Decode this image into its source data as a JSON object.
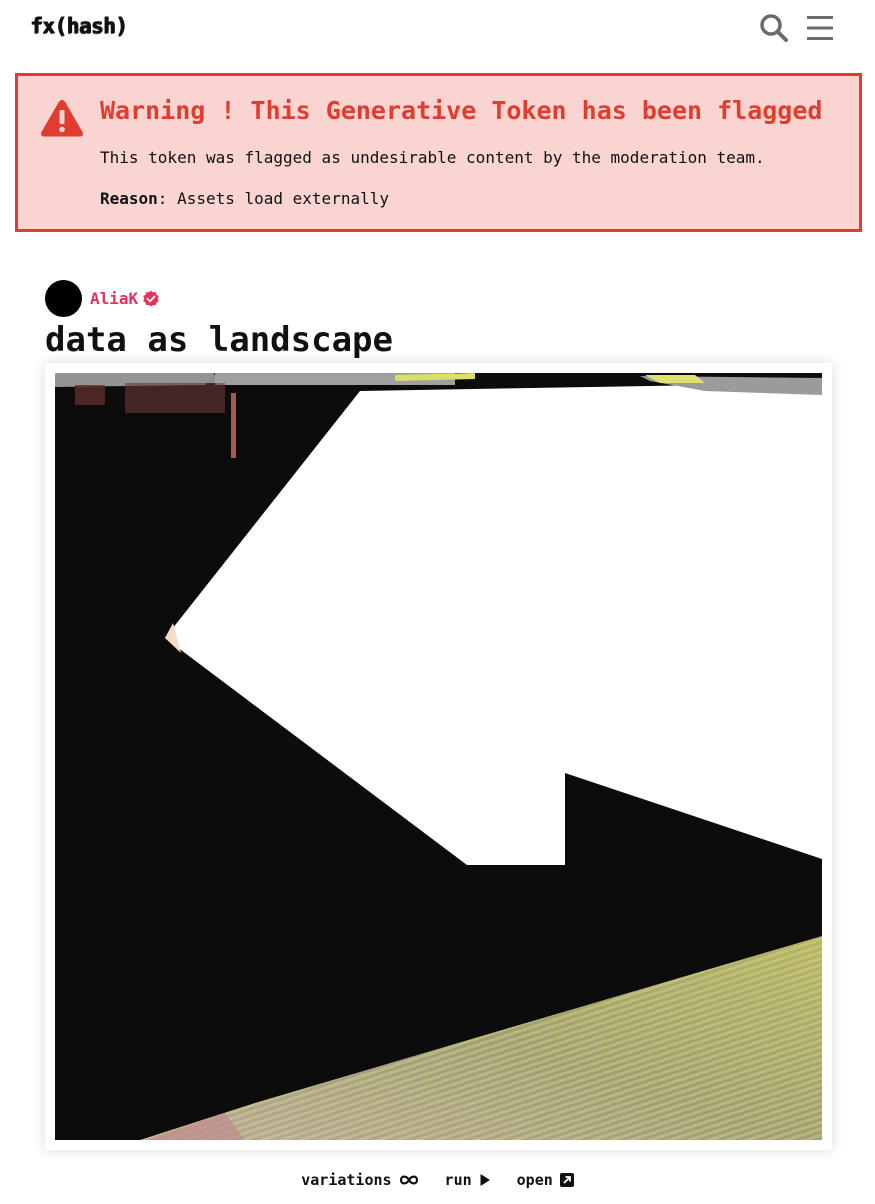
{
  "header": {
    "logo": "fx(hash)",
    "search_icon": "search-icon",
    "menu_icon": "hamburger-menu-icon"
  },
  "warning": {
    "icon": "warning-triangle-icon",
    "title": "Warning ! This Generative Token has been flagged",
    "message": "This token was flagged as undesirable content by the moderation team.",
    "reason_label": "Reason",
    "reason_value": ": Assets load externally",
    "color": "#e03d2f",
    "background": "#f9d4d0"
  },
  "author": {
    "name": "AliaK",
    "verified_icon": "verified-badge-icon",
    "color": "#e8305c"
  },
  "token": {
    "title": "data as landscape"
  },
  "actions": {
    "variations_label": "variations",
    "run_label": "run",
    "open_label": "open"
  }
}
